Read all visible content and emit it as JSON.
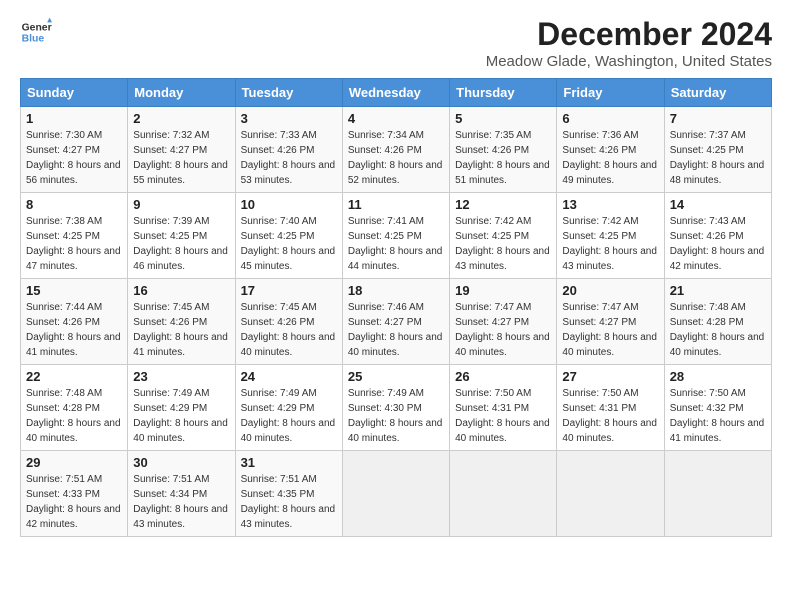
{
  "header": {
    "logo_line1": "General",
    "logo_line2": "Blue",
    "title": "December 2024",
    "subtitle": "Meadow Glade, Washington, United States"
  },
  "days_of_week": [
    "Sunday",
    "Monday",
    "Tuesday",
    "Wednesday",
    "Thursday",
    "Friday",
    "Saturday"
  ],
  "weeks": [
    [
      {
        "day": "1",
        "sunrise": "7:30 AM",
        "sunset": "4:27 PM",
        "daylight": "8 hours and 56 minutes."
      },
      {
        "day": "2",
        "sunrise": "7:32 AM",
        "sunset": "4:27 PM",
        "daylight": "8 hours and 55 minutes."
      },
      {
        "day": "3",
        "sunrise": "7:33 AM",
        "sunset": "4:26 PM",
        "daylight": "8 hours and 53 minutes."
      },
      {
        "day": "4",
        "sunrise": "7:34 AM",
        "sunset": "4:26 PM",
        "daylight": "8 hours and 52 minutes."
      },
      {
        "day": "5",
        "sunrise": "7:35 AM",
        "sunset": "4:26 PM",
        "daylight": "8 hours and 51 minutes."
      },
      {
        "day": "6",
        "sunrise": "7:36 AM",
        "sunset": "4:26 PM",
        "daylight": "8 hours and 49 minutes."
      },
      {
        "day": "7",
        "sunrise": "7:37 AM",
        "sunset": "4:25 PM",
        "daylight": "8 hours and 48 minutes."
      }
    ],
    [
      {
        "day": "8",
        "sunrise": "7:38 AM",
        "sunset": "4:25 PM",
        "daylight": "8 hours and 47 minutes."
      },
      {
        "day": "9",
        "sunrise": "7:39 AM",
        "sunset": "4:25 PM",
        "daylight": "8 hours and 46 minutes."
      },
      {
        "day": "10",
        "sunrise": "7:40 AM",
        "sunset": "4:25 PM",
        "daylight": "8 hours and 45 minutes."
      },
      {
        "day": "11",
        "sunrise": "7:41 AM",
        "sunset": "4:25 PM",
        "daylight": "8 hours and 44 minutes."
      },
      {
        "day": "12",
        "sunrise": "7:42 AM",
        "sunset": "4:25 PM",
        "daylight": "8 hours and 43 minutes."
      },
      {
        "day": "13",
        "sunrise": "7:42 AM",
        "sunset": "4:25 PM",
        "daylight": "8 hours and 43 minutes."
      },
      {
        "day": "14",
        "sunrise": "7:43 AM",
        "sunset": "4:26 PM",
        "daylight": "8 hours and 42 minutes."
      }
    ],
    [
      {
        "day": "15",
        "sunrise": "7:44 AM",
        "sunset": "4:26 PM",
        "daylight": "8 hours and 41 minutes."
      },
      {
        "day": "16",
        "sunrise": "7:45 AM",
        "sunset": "4:26 PM",
        "daylight": "8 hours and 41 minutes."
      },
      {
        "day": "17",
        "sunrise": "7:45 AM",
        "sunset": "4:26 PM",
        "daylight": "8 hours and 40 minutes."
      },
      {
        "day": "18",
        "sunrise": "7:46 AM",
        "sunset": "4:27 PM",
        "daylight": "8 hours and 40 minutes."
      },
      {
        "day": "19",
        "sunrise": "7:47 AM",
        "sunset": "4:27 PM",
        "daylight": "8 hours and 40 minutes."
      },
      {
        "day": "20",
        "sunrise": "7:47 AM",
        "sunset": "4:27 PM",
        "daylight": "8 hours and 40 minutes."
      },
      {
        "day": "21",
        "sunrise": "7:48 AM",
        "sunset": "4:28 PM",
        "daylight": "8 hours and 40 minutes."
      }
    ],
    [
      {
        "day": "22",
        "sunrise": "7:48 AM",
        "sunset": "4:28 PM",
        "daylight": "8 hours and 40 minutes."
      },
      {
        "day": "23",
        "sunrise": "7:49 AM",
        "sunset": "4:29 PM",
        "daylight": "8 hours and 40 minutes."
      },
      {
        "day": "24",
        "sunrise": "7:49 AM",
        "sunset": "4:29 PM",
        "daylight": "8 hours and 40 minutes."
      },
      {
        "day": "25",
        "sunrise": "7:49 AM",
        "sunset": "4:30 PM",
        "daylight": "8 hours and 40 minutes."
      },
      {
        "day": "26",
        "sunrise": "7:50 AM",
        "sunset": "4:31 PM",
        "daylight": "8 hours and 40 minutes."
      },
      {
        "day": "27",
        "sunrise": "7:50 AM",
        "sunset": "4:31 PM",
        "daylight": "8 hours and 40 minutes."
      },
      {
        "day": "28",
        "sunrise": "7:50 AM",
        "sunset": "4:32 PM",
        "daylight": "8 hours and 41 minutes."
      }
    ],
    [
      {
        "day": "29",
        "sunrise": "7:51 AM",
        "sunset": "4:33 PM",
        "daylight": "8 hours and 42 minutes."
      },
      {
        "day": "30",
        "sunrise": "7:51 AM",
        "sunset": "4:34 PM",
        "daylight": "8 hours and 43 minutes."
      },
      {
        "day": "31",
        "sunrise": "7:51 AM",
        "sunset": "4:35 PM",
        "daylight": "8 hours and 43 minutes."
      },
      null,
      null,
      null,
      null
    ]
  ],
  "labels": {
    "sunrise": "Sunrise: ",
    "sunset": "Sunset: ",
    "daylight": "Daylight: "
  }
}
